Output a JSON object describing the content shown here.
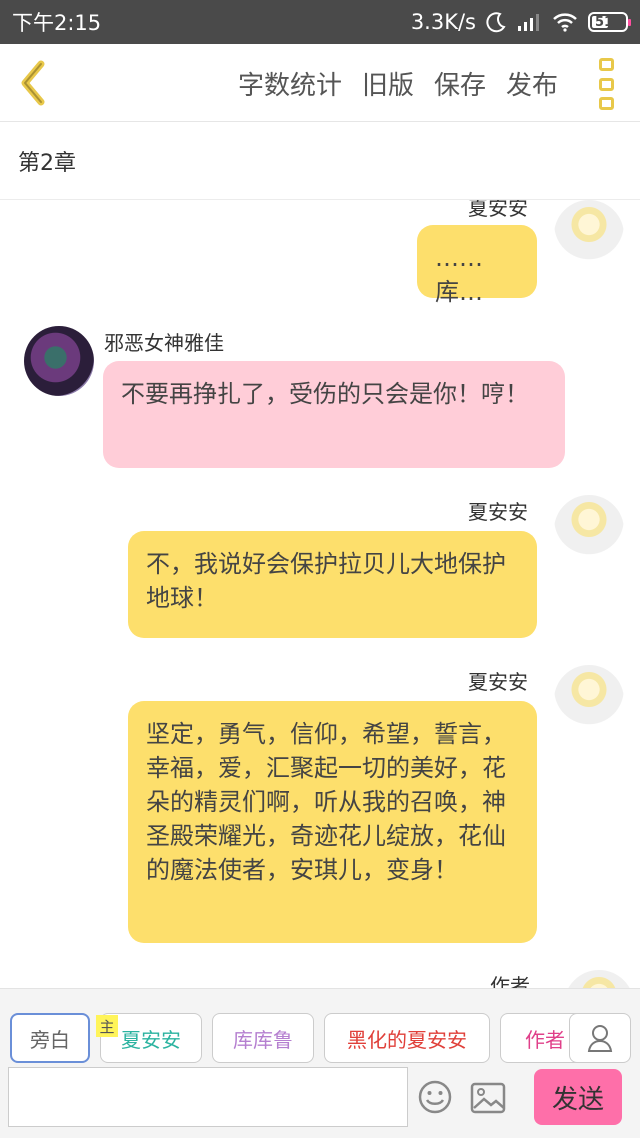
{
  "status_bar": {
    "time": "下午2:15",
    "network_speed": "3.3K/s",
    "battery_level": "51"
  },
  "header": {
    "actions": [
      {
        "label": "字数统计"
      },
      {
        "label": "旧版"
      },
      {
        "label": "保存"
      },
      {
        "label": "发布"
      }
    ]
  },
  "chapter": {
    "title": "第2章"
  },
  "messages": [
    {
      "speaker": "夏安安",
      "side": "right",
      "color": "yellow",
      "text": "……库…"
    },
    {
      "speaker": "邪恶女神雅佳",
      "side": "left",
      "color": "pink",
      "text": "不要再挣扎了，受伤的只会是你！哼！"
    },
    {
      "speaker": "夏安安",
      "side": "right",
      "color": "yellow",
      "text": "不，我说好会保护拉贝儿大地保护地球！"
    },
    {
      "speaker": "夏安安",
      "side": "right",
      "color": "yellow",
      "text": "坚定，勇气，信仰，希望，誓言，幸福，爱，汇聚起一切的美好，花朵的精灵们啊，听从我的召唤，神圣殿荣耀光，奇迹花儿绽放，花仙的魔法使者，安琪儿，变身！"
    },
    {
      "speaker": "作者",
      "side": "right",
      "color": "yellow",
      "text": ""
    }
  ],
  "roles": [
    {
      "label": "旁白",
      "color": "#666666"
    },
    {
      "label": "夏安安",
      "color": "#2bb3a0"
    },
    {
      "label": "库库鲁",
      "color": "#b57fd0"
    },
    {
      "label": "黑化的夏安安",
      "color": "#e0403a"
    },
    {
      "label": "作者",
      "color": "#e0408a"
    }
  ],
  "main_tag": "主",
  "input": {
    "value": "",
    "placeholder": ""
  },
  "send_label": "发送",
  "colors": {
    "yellow_bubble": "#fddf6c",
    "pink_bubble": "#ffcdd8",
    "send_button": "#fe6fa9",
    "accent": "#e8c84a"
  },
  "icons": [
    "back-chevron-icon",
    "moon-icon",
    "signal-icon",
    "wifi-icon",
    "battery-icon",
    "more-menu-icon",
    "person-icon",
    "emoji-icon",
    "image-icon"
  ]
}
